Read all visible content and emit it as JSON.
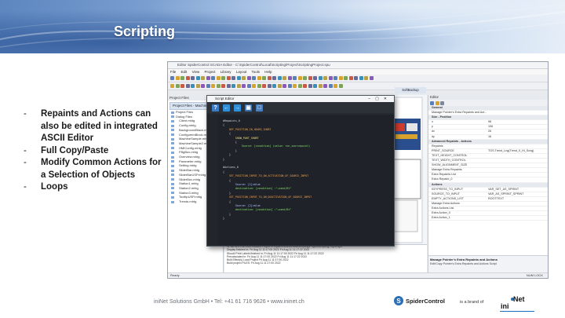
{
  "slide": {
    "title": "Scripting",
    "bullets": [
      "Repaints and Actions can also be edited in integrated ASCII Editor",
      "Full Copy/Paste",
      "Modify Common Actions for a Selection of Objects",
      "Loops"
    ],
    "bullet_marker": "-",
    "footer": "iniNet Solutions GmbH • Tel: +41 61 716 9626 • www.ininet.ch",
    "brand_logo": "SpiderControl",
    "brand_suffix": "is a brand of",
    "company_logo_ini": "ini",
    "company_logo_net": "Net"
  },
  "app": {
    "title": "Editor SpiderControl SCADA Editor - C:\\SpiderControl\\Local\\Scripting\\Project\\ScriptingProject.spu",
    "menu": [
      "File",
      "Edit",
      "View",
      "Project",
      "Library",
      "Layout",
      "Tools",
      "Help"
    ],
    "project_panel_title": "Project Files",
    "project_tab": "Project Files - Machine",
    "tree_items": [
      "Project Files",
      "Dialog Files",
      "Client.mhtg",
      "Config.mhtg",
      "BackgroundBlack.mhtg",
      "ConfigureInBlock.mhtg",
      "MachineSample.mhtg",
      "MachineSample2.mhtg",
      "HMIConfig.mhtg",
      "FBgBox.mhtg",
      "Overview.mhtg",
      "Parameter.mhtg",
      "Setting.mhtg",
      "SliderBar.mhtg",
      "SliderBarUSP.mhtg",
      "SliderBox.mhtg",
      "Station1.mhtg",
      "Station2.mhtg",
      "Station3.mhtg",
      "TooltipUSP.mhtg",
      "Trends.mhtg"
    ],
    "document_tab": "SoftBackup",
    "properties_title": "Editor",
    "properties": [
      {
        "k": "General",
        "v": "",
        "section": true
      },
      {
        "k": "Manage Pointer's Extra Repaints and Act...",
        "v": "",
        "section": false
      },
      {
        "k": "Size - Position",
        "v": "",
        "section": true
      },
      {
        "k": "x",
        "v": "98",
        "section": false
      },
      {
        "k": "y",
        "v": "106",
        "section": false
      },
      {
        "k": "dx",
        "v": "26",
        "section": false
      },
      {
        "k": "dy",
        "v": "16",
        "section": false
      },
      {
        "k": "Advanced Repaints - Actions",
        "v": "",
        "section": true
      },
      {
        "k": "Repaints",
        "v": "",
        "section": false
      },
      {
        "k": "PRINT_SOURCE",
        "v": "TGS.Trend_Lng(Trend_0_Hi_Scng)",
        "section": false
      },
      {
        "k": "TEXT_HEIGHT_CONTROL",
        "v": "",
        "section": false
      },
      {
        "k": "TEXT_WIDTH_CONTROL",
        "v": "",
        "section": false
      },
      {
        "k": "SHOW_ALIGNMENT_SIZE",
        "v": "",
        "section": false
      },
      {
        "k": "Manage Extra Repaints",
        "v": "",
        "section": false
      },
      {
        "k": "Extra Repaints List",
        "v": "",
        "section": false
      },
      {
        "k": "Extra Repaint_0",
        "v": "",
        "section": false
      },
      {
        "k": "Actions",
        "v": "",
        "section": true
      },
      {
        "k": "KEYPRESS_TO_INPUT",
        "v": "VAR_SET_AS_SPRINT",
        "section": false
      },
      {
        "k": "SOURCE_TO_INPUT",
        "v": "VAR_AS_SPRINT_SPRINT",
        "section": false
      },
      {
        "k": "EMPTY_ACTIONS_LIST",
        "v": "ROOTTEXT",
        "section": false
      },
      {
        "k": "Manage Extra Actions",
        "v": "",
        "section": false
      },
      {
        "k": "Extra Actions List",
        "v": "",
        "section": false
      },
      {
        "k": "Extra Action_0",
        "v": "",
        "section": false
      },
      {
        "k": "Extra Action_1",
        "v": "",
        "section": false
      }
    ],
    "properties_desc_title": "Manage Pointer's Extra Repaints and Actions",
    "properties_desc_text": "Edit/Copy Pointer's Extra Repaints and Actions Script",
    "output_lines": [
      "12 Jul 11:17:42 2021 Loaded Project C:\\SpiderControl\\Local\\Scripting\\Project\\ScriptingProject.spu",
      "Display finished in: Fri Aug 11 11:17:00 2022 Fri Aug 11 11:17:22 2022",
      "Should Print Labels finished in: Fri Aug 11 11:17:00 2022 Fri Aug 11 11:17:22 2022",
      "Precalculated in: Fri Aug 11 11:17:00 2022 Fri Aug 11 11:17:22 2022",
      "Built Effect(s) Load Project Fri Aug 11 11:17:00 2022",
      "Build project FILES: Fri Aug 11 11:17:00 2022"
    ],
    "status_left": "Ready",
    "status_right": "NUM  LOCK"
  },
  "editor": {
    "title": "Script Editor",
    "window_buttons": "–▢✕",
    "toolbar": [
      "help-button",
      "undo-button",
      "redo-button",
      "save-button",
      "open-button"
    ],
    "code": [
      {
        "t": "#Repaints_0",
        "c": "c-wht"
      },
      {
        "t": "{",
        "c": "c-wht"
      },
      {
        "t": "    DEF_POSITION_IN_HOURS_SHORT",
        "c": "c-def"
      },
      {
        "t": "    {",
        "c": "c-wht"
      },
      {
        "t": "        SHOW_PART_SHORT",
        "c": "c-str"
      },
      {
        "t": "        {",
        "c": "c-wht"
      },
      {
        "t": "            Source: [condition] (value: run_sourcepoint)",
        "c": "c-val"
      },
      {
        "t": "        }",
        "c": "c-wht"
      },
      {
        "t": "    }",
        "c": "c-wht"
      },
      {
        "t": "}",
        "c": "c-wht"
      },
      {
        "t": "",
        "c": "c-wht"
      },
      {
        "t": "#Actions_0",
        "c": "c-wht"
      },
      {
        "t": "{",
        "c": "c-wht"
      },
      {
        "t": "    SET_POSITION_INPUT_TO_ON_ACTIVATION_OF_SOURCE_INPUT",
        "c": "c-def"
      },
      {
        "t": "    {",
        "c": "c-wht"
      },
      {
        "t": "        Source: [1]value",
        "c": "c-key"
      },
      {
        "t": "        destination: [condition] :\"+send/Bt\"",
        "c": "c-val"
      },
      {
        "t": "    }",
        "c": "c-wht"
      },
      {
        "t": "    SET_POSITION_INPUT_TO_ON_DEACTIVATION_OF_SOURCE_INPUT",
        "c": "c-def"
      },
      {
        "t": "    {",
        "c": "c-wht"
      },
      {
        "t": "        Source: [2]value",
        "c": "c-key"
      },
      {
        "t": "        destination: [condition] :\"+send/Bt\"",
        "c": "c-val"
      },
      {
        "t": "    }",
        "c": "c-wht"
      },
      {
        "t": "}",
        "c": "c-wht"
      }
    ]
  },
  "colors": {
    "banner_blue": "#5d86bf",
    "editor_bg": "#1f2329",
    "accent_blue": "#2a6fb8"
  }
}
